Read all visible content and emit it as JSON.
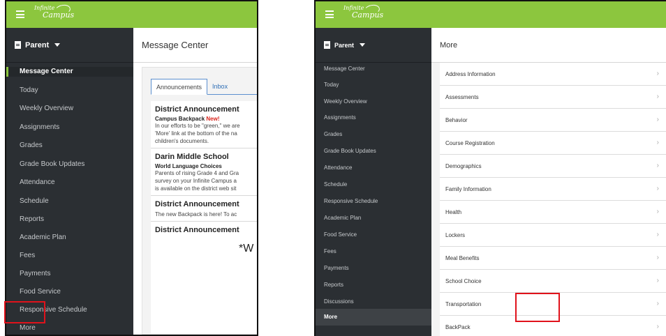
{
  "logo": {
    "line1": "Infinite",
    "line2": "Campus"
  },
  "left_panel": {
    "role_label": "Parent",
    "page_title": "Message Center",
    "sidebar_items": [
      "Message Center",
      "Today",
      "Weekly Overview",
      "Assignments",
      "Grades",
      "Grade Book Updates",
      "Attendance",
      "Schedule",
      "Reports",
      "Academic Plan",
      "Fees",
      "Payments",
      "Food Service",
      "Responsive Schedule",
      "More"
    ],
    "tabs": [
      "Announcements",
      "Inbox"
    ],
    "announcements": [
      {
        "title": "District Announcement",
        "subtitle": "Campus Backpack",
        "badge": "New!",
        "lines": [
          "In our efforts to be \"green,\" we are",
          "'More' link at the bottom of the na",
          "children's documents."
        ]
      },
      {
        "title": "Darin Middle School",
        "subtitle": "World Language Choices",
        "lines": [
          "Parents of rising Grade 4 and Gra",
          "survey on your Infinite Campus a",
          "is available on the district web sit"
        ]
      },
      {
        "title": "District Announcement",
        "lines": [
          "The new Backpack is here!  To ac"
        ]
      },
      {
        "title": "District Announcement",
        "big_text": "*W"
      }
    ]
  },
  "right_panel": {
    "role_label": "Parent",
    "page_title": "More",
    "sidebar_items": [
      "Message Center",
      "Today",
      "Weekly Overview",
      "Assignments",
      "Grades",
      "Grade Book Updates",
      "Attendance",
      "Schedule",
      "Responsive Schedule",
      "Academic Plan",
      "Food Service",
      "Fees",
      "Payments",
      "Reports",
      "Discussions",
      "More"
    ],
    "more_items": [
      "Address Information",
      "Assessments",
      "Behavior",
      "Course Registration",
      "Demographics",
      "Family Information",
      "Health",
      "Lockers",
      "Meal Benefits",
      "School Choice",
      "Transportation",
      "BackPack"
    ]
  },
  "colors": {
    "brand_green": "#8cc63e",
    "sidebar_bg": "#2b2f33",
    "highlight_red": "#e0121b"
  },
  "icons": {
    "menu": "hamburger-icon",
    "role_caret": "caret-down-icon",
    "row_chevron": "chevron-right-icon"
  }
}
